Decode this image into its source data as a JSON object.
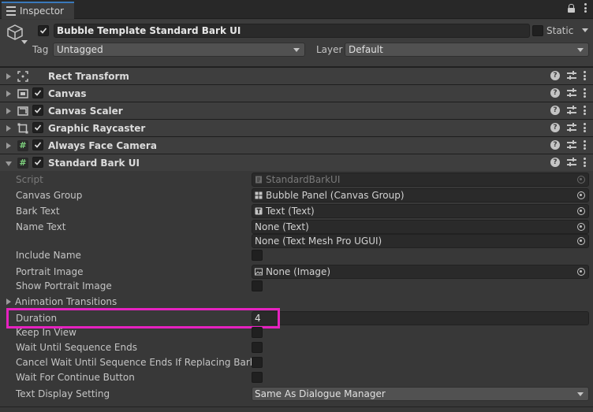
{
  "window": {
    "tab_title": "Inspector"
  },
  "header": {
    "object_name": "Bubble Template Standard Bark UI",
    "static_label": "Static",
    "tag_label": "Tag",
    "tag_value": "Untagged",
    "layer_label": "Layer",
    "layer_value": "Default"
  },
  "components": [
    {
      "title": "Rect Transform",
      "icon": "rect-transform-icon",
      "has_checkbox": false
    },
    {
      "title": "Canvas",
      "icon": "canvas-icon",
      "has_checkbox": true
    },
    {
      "title": "Canvas Scaler",
      "icon": "canvas-scaler-icon",
      "has_checkbox": true
    },
    {
      "title": "Graphic Raycaster",
      "icon": "graphic-raycaster-icon",
      "has_checkbox": true
    },
    {
      "title": "Always Face Camera",
      "icon": "script-icon",
      "has_checkbox": true
    },
    {
      "title": "Standard Bark UI",
      "icon": "script-icon",
      "has_checkbox": true,
      "expanded": true
    }
  ],
  "properties": {
    "script_label": "Script",
    "script_value": "StandardBarkUI",
    "canvas_group_label": "Canvas Group",
    "canvas_group_value": "Bubble Panel (Canvas Group)",
    "bark_text_label": "Bark Text",
    "bark_text_value": "Text (Text)",
    "name_text_label": "Name Text",
    "name_text_value": "None (Text)",
    "name_text_tmp_value": "None (Text Mesh Pro UGUI)",
    "include_name_label": "Include Name",
    "portrait_image_label": "Portrait Image",
    "portrait_image_value": "None (Image)",
    "show_portrait_label": "Show Portrait Image",
    "animation_transitions_label": "Animation Transitions",
    "duration_label": "Duration",
    "duration_value": "4",
    "keep_in_view_label": "Keep In View",
    "wait_until_label": "Wait Until Sequence Ends",
    "cancel_wait_label": "Cancel Wait Until Sequence Ends If Replacing Bark",
    "wait_continue_label": "Wait For Continue Button",
    "text_display_label": "Text Display Setting",
    "text_display_value": "Same As Dialogue Manager"
  },
  "colors": {
    "highlight": "#e622c0",
    "tab_accent": "#3a79bb",
    "script_icon": "#7ed27e"
  }
}
